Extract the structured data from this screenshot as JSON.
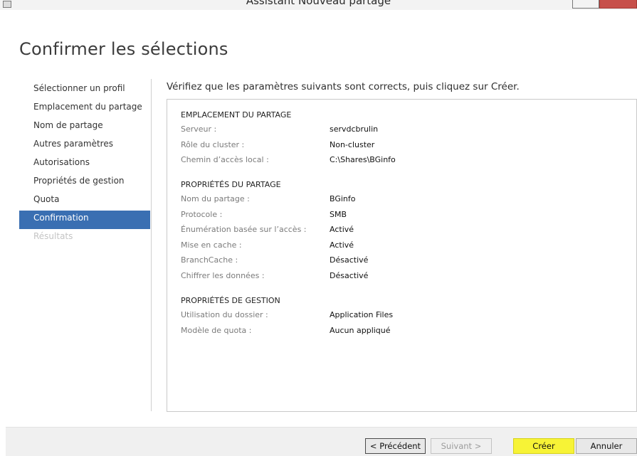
{
  "window": {
    "title": "Assistant Nouveau partage"
  },
  "page": {
    "title": "Confirmer les sélections",
    "instruction": "Vérifiez que les paramètres suivants sont corrects, puis cliquez sur Créer."
  },
  "steps": [
    {
      "label": "Sélectionner un profil",
      "state": "normal"
    },
    {
      "label": "Emplacement du partage",
      "state": "normal"
    },
    {
      "label": "Nom de partage",
      "state": "normal"
    },
    {
      "label": "Autres paramètres",
      "state": "normal"
    },
    {
      "label": "Autorisations",
      "state": "normal"
    },
    {
      "label": "Propriétés de gestion",
      "state": "normal"
    },
    {
      "label": "Quota",
      "state": "normal"
    },
    {
      "label": "Confirmation",
      "state": "active"
    },
    {
      "label": "Résultats",
      "state": "disabled"
    }
  ],
  "sections": [
    {
      "heading": "EMPLACEMENT DU PARTAGE",
      "rows": [
        {
          "key": "Serveur :",
          "value": "servdcbrulin"
        },
        {
          "key": "Rôle du cluster :",
          "value": "Non-cluster"
        },
        {
          "key": "Chemin d’accès local :",
          "value": "C:\\Shares\\BGinfo"
        }
      ]
    },
    {
      "heading": "PROPRIÉTÉS DU PARTAGE",
      "rows": [
        {
          "key": "Nom du partage :",
          "value": "BGinfo"
        },
        {
          "key": "Protocole :",
          "value": "SMB"
        },
        {
          "key": "Énumération basée sur l’accès :",
          "value": "Activé"
        },
        {
          "key": "Mise en cache :",
          "value": "Activé"
        },
        {
          "key": "BranchCache :",
          "value": "Désactivé"
        },
        {
          "key": "Chiffrer les données :",
          "value": "Désactivé"
        }
      ]
    },
    {
      "heading": "PROPRIÉTÉS DE GESTION",
      "rows": [
        {
          "key": "Utilisation du dossier :",
          "value": "Application Files"
        },
        {
          "key": "Modèle de quota :",
          "value": "Aucun appliqué"
        }
      ]
    }
  ],
  "buttons": {
    "previous": "< Précédent",
    "next": "Suivant >",
    "create": "Créer",
    "cancel": "Annuler"
  },
  "colors": {
    "active_step": "#3a6fb2",
    "highlight": "#f7f336"
  }
}
